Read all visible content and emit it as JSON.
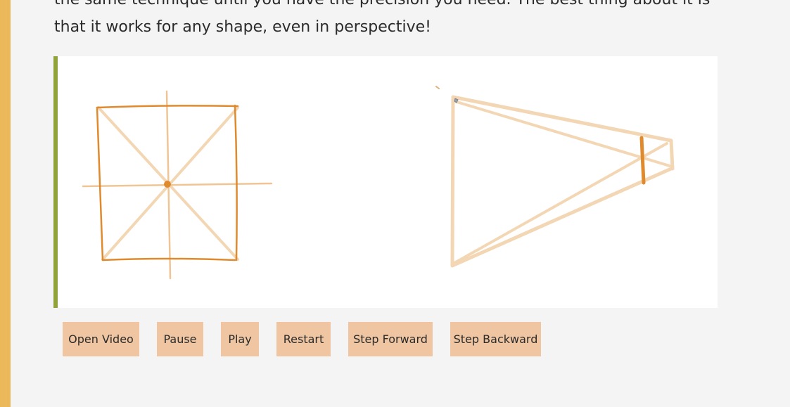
{
  "article": {
    "line1": "the same technique until you have the precision you need. The best thing about it is",
    "line2": "that it works for any shape, even in perspective!"
  },
  "video_controls": {
    "open_video": "Open Video",
    "pause": "Pause",
    "play": "Play",
    "restart": "Restart",
    "step_forward": "Step Forward",
    "step_backward": "Step Backward"
  },
  "colors": {
    "page_background": "#f4f4f4",
    "left_accent": "#ecb95a",
    "canvas_border": "#8fa33a",
    "stroke_dark": "#e08a2e",
    "stroke_light": "#f3d7b4",
    "button_bg": "#efc6a1"
  }
}
